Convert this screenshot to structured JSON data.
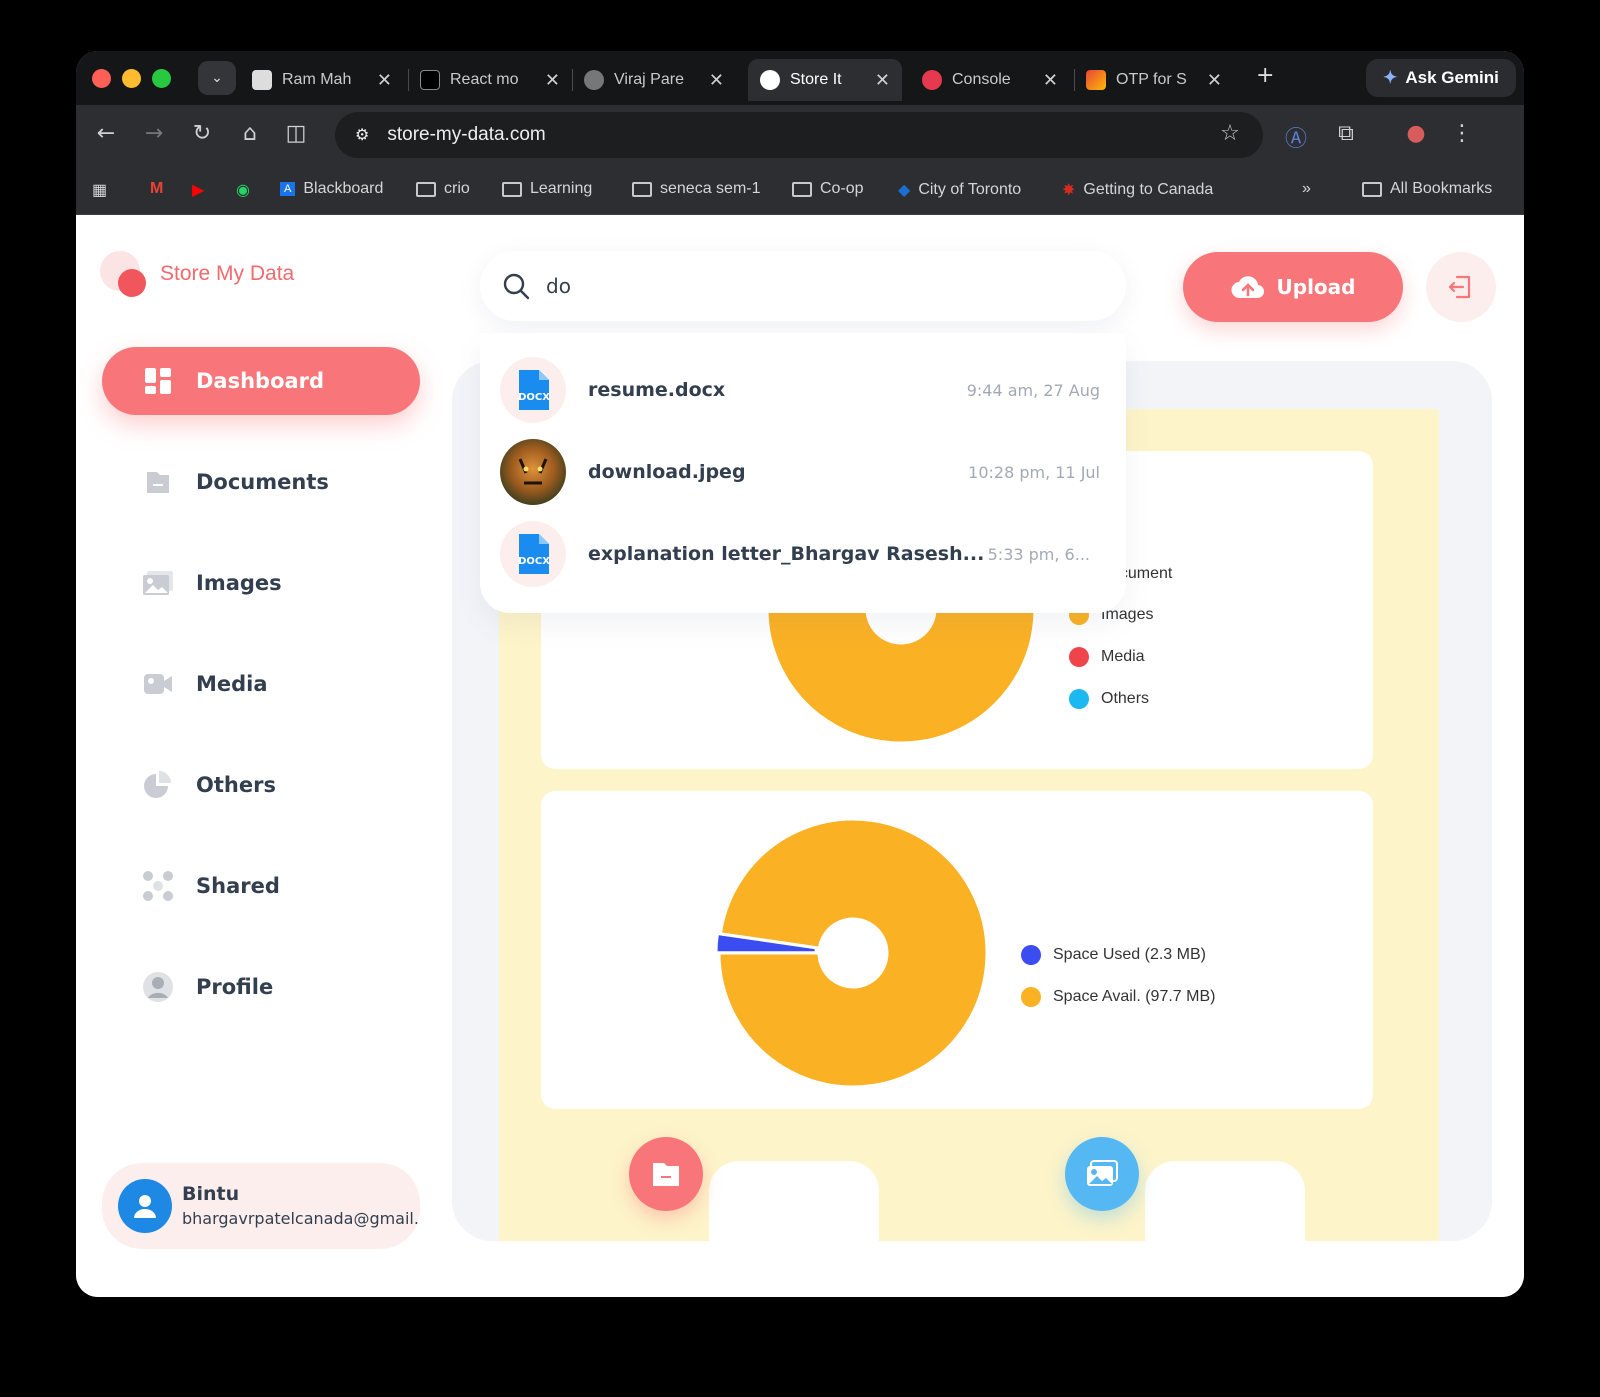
{
  "browser": {
    "tabs": [
      {
        "label": "Ram Mah",
        "active": false
      },
      {
        "label": "React mo",
        "active": false
      },
      {
        "label": "Viraj Pare",
        "active": false
      },
      {
        "label": "Store It",
        "active": true
      },
      {
        "label": "Console",
        "active": false
      },
      {
        "label": "OTP for S",
        "active": false
      }
    ],
    "gemini_label": "Ask Gemini",
    "url": "store-my-data.com",
    "bookmarks": [
      "Blackboard",
      "crio",
      "Learning",
      "seneca sem-1",
      "Co-op",
      "City of Toronto",
      "Getting to Canada"
    ],
    "all_bookmarks": "All Bookmarks"
  },
  "app": {
    "logo_text": "Store My Data",
    "nav": [
      {
        "label": "Dashboard",
        "icon": "dashboard-icon",
        "active": true
      },
      {
        "label": "Documents",
        "icon": "document-icon",
        "active": false
      },
      {
        "label": "Images",
        "icon": "image-icon",
        "active": false
      },
      {
        "label": "Media",
        "icon": "video-icon",
        "active": false
      },
      {
        "label": "Others",
        "icon": "pie-icon",
        "active": false
      },
      {
        "label": "Shared",
        "icon": "share-icon",
        "active": false
      },
      {
        "label": "Profile",
        "icon": "user-icon",
        "active": false
      }
    ],
    "user": {
      "name": "Bintu",
      "email": "bhargavrpatelcanada@gmail.com"
    },
    "search": {
      "value": "do"
    },
    "upload_label": "Upload",
    "results": [
      {
        "name": "resume.docx",
        "date": "9:44 am, 27 Aug",
        "type": "docx"
      },
      {
        "name": "download.jpeg",
        "date": "10:28 pm, 11 Jul",
        "type": "image"
      },
      {
        "name": "explanation letter_Bhargav Rasesh...",
        "date": "5:33 pm, 6...",
        "type": "docx"
      }
    ],
    "docx_badge": "DOCX",
    "chart1_legend": [
      {
        "label": "ocument",
        "color": "#3b4cf0"
      },
      {
        "label": "Images",
        "color": "#fbb124"
      },
      {
        "label": "Media",
        "color": "#f0444d"
      },
      {
        "label": "Others",
        "color": "#1bb8f1"
      }
    ],
    "chart2_legend": [
      {
        "label": "Space Used (2.3 MB)",
        "color": "#3b4cf0"
      },
      {
        "label": "Space Avail. (97.7 MB)",
        "color": "#fbb124"
      }
    ]
  },
  "chart_data": [
    {
      "type": "pie",
      "categories": [
        "Document",
        "Images",
        "Media",
        "Others"
      ],
      "values": [
        2,
        98,
        0,
        0
      ],
      "colors": [
        "#3b4cf0",
        "#fbb124",
        "#f0444d",
        "#1bb8f1"
      ]
    },
    {
      "type": "pie",
      "categories": [
        "Space Used (2.3 MB)",
        "Space Avail. (97.7 MB)"
      ],
      "values": [
        2.3,
        97.7
      ],
      "colors": [
        "#3b4cf0",
        "#fbb124"
      ]
    }
  ]
}
